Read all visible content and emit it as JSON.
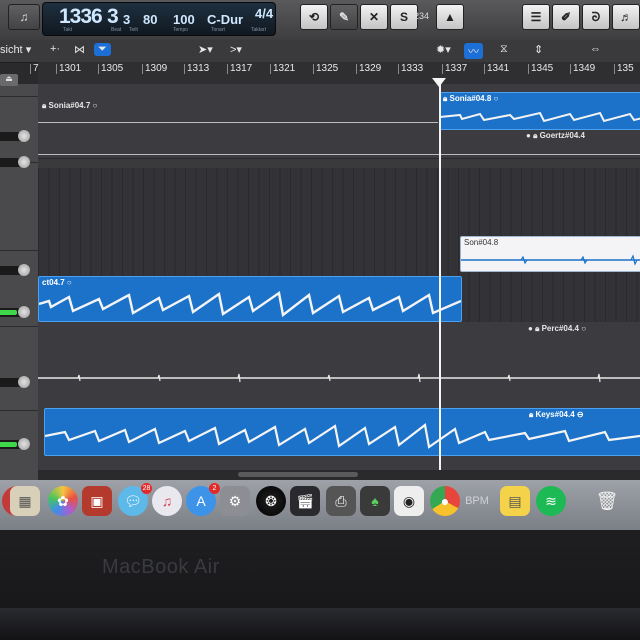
{
  "lcd": {
    "bar": "1336",
    "beat": "3",
    "division": "3",
    "tempo": "80",
    "key_sig_value": "100",
    "key": "C-Dur",
    "time_signature": "4/4",
    "caption_bar": "Takt",
    "caption_beat": "Beat",
    "caption_division": "Teilt",
    "caption_tempo": "Tempo",
    "caption_key": "Tonart",
    "caption_sig": "Taktart"
  },
  "controlbar": {
    "count_in_label": "1234",
    "count_label": "S"
  },
  "toolbar": {
    "view_label": "sicht"
  },
  "ruler": {
    "bars": [
      "7",
      "1301",
      "1305",
      "1309",
      "1313",
      "1317",
      "1321",
      "1325",
      "1329",
      "1333",
      "1337",
      "1341",
      "1345",
      "1349",
      "135"
    ]
  },
  "regions": {
    "sonia_left": "Sonia#04.7",
    "sonia_right": "Sonia#04.8",
    "goertz": "Goertz#04.4",
    "white_region": "Son#04.8",
    "vocal_left": "ct04.7",
    "perc": "Perc#04.4",
    "keys": "Keys#04.4"
  },
  "dock": {
    "badge_messages": "28",
    "badge_appstore": "2",
    "bpm_label": "BPM",
    "apps": [
      "photos",
      "preview",
      "dashboard",
      "messages",
      "safari",
      "app-store",
      "system-preferences",
      "aperture",
      "final-cut",
      "printer",
      "evernote",
      "logo-app",
      "chrome",
      "bpm",
      "stickies",
      "spotify",
      "trash"
    ]
  },
  "bezel": {
    "label": "MacBook Air"
  },
  "colors": {
    "region_blue": "#1c72c9",
    "lcd_text": "#cfe7ff",
    "selection_blue": "#1d6fd8"
  }
}
